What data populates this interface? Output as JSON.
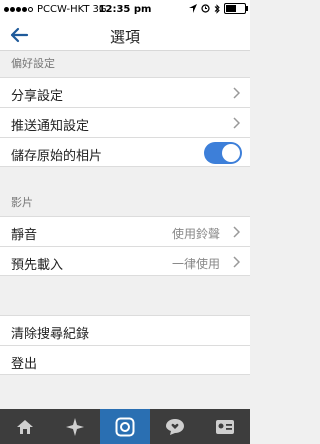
{
  "status": {
    "carrier": "PCCW-HKT",
    "network": "3G",
    "time": "12:35 pm"
  },
  "nav": {
    "title": "選項"
  },
  "sections": {
    "preferences": {
      "header": "偏好設定",
      "share": "分享設定",
      "push": "推送通知設定",
      "save_original": "儲存原始的相片",
      "save_original_on": true
    },
    "video": {
      "header": "影片",
      "mute": "靜音",
      "mute_value": "使用鈴聲",
      "preload": "預先載入",
      "preload_value": "一律使用"
    },
    "account": {
      "clear_history": "清除搜尋紀錄",
      "logout": "登出"
    }
  },
  "tabs": [
    "home",
    "explore",
    "camera",
    "news",
    "profile"
  ],
  "colors": {
    "accent": "#3d7fd9",
    "tabbar": "#3d3d3d",
    "tab_active": "#2a6fb2"
  }
}
